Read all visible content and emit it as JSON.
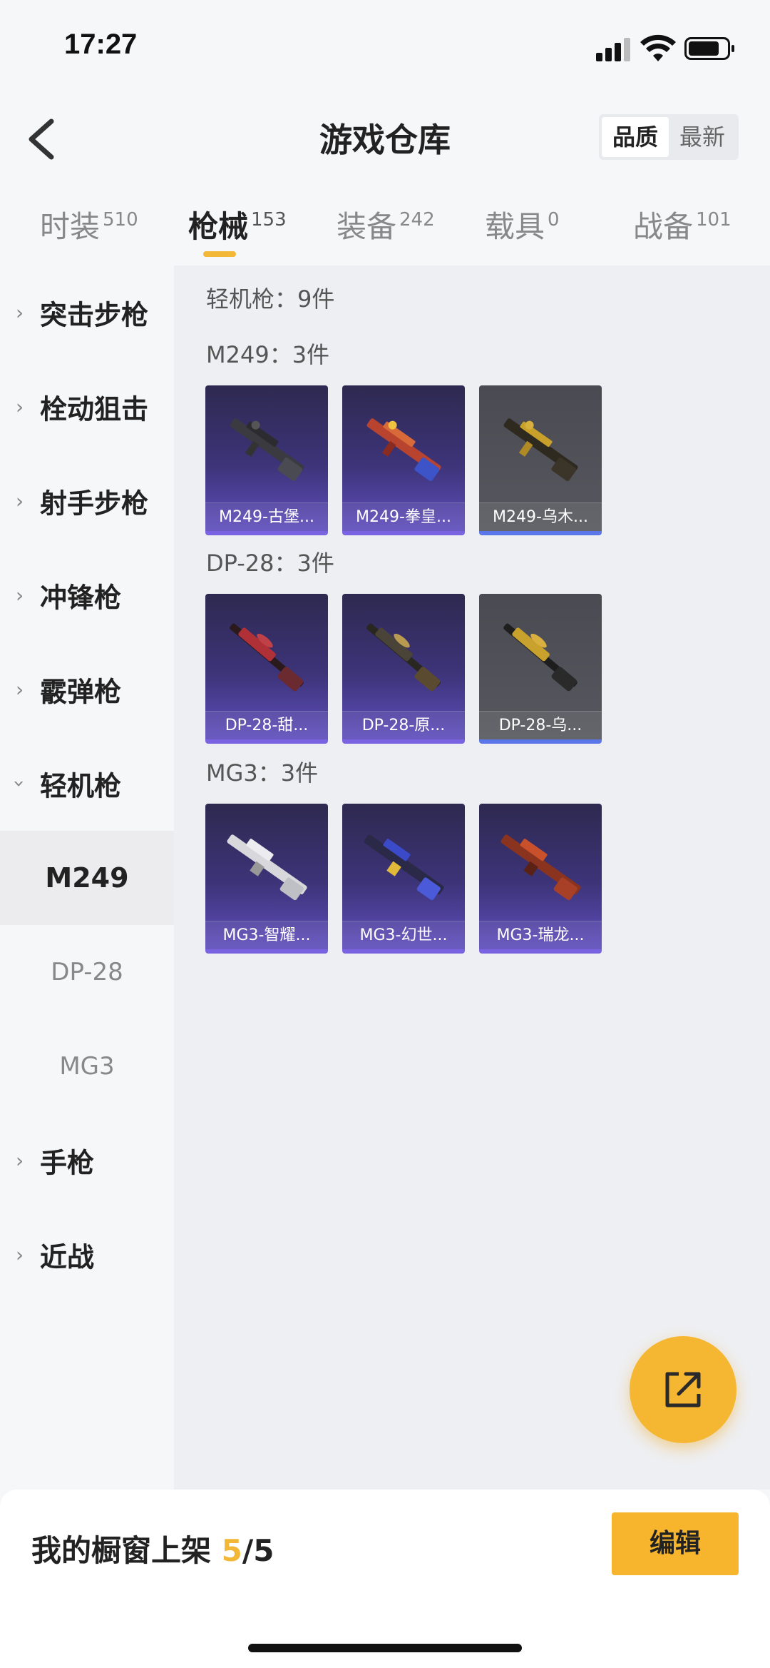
{
  "status": {
    "time": "17:27"
  },
  "header": {
    "title": "游戏仓库",
    "sort_options": [
      "品质",
      "最新"
    ],
    "sort_active": "品质"
  },
  "tabs": [
    {
      "label": "时装",
      "count": "510"
    },
    {
      "label": "枪械",
      "count": "153",
      "active": true
    },
    {
      "label": "装备",
      "count": "242"
    },
    {
      "label": "载具",
      "count": "0"
    },
    {
      "label": "战备",
      "count": "101"
    }
  ],
  "sidebar": {
    "categories": [
      {
        "label": "突击步枪"
      },
      {
        "label": "栓动狙击"
      },
      {
        "label": "射手步枪"
      },
      {
        "label": "冲锋枪"
      },
      {
        "label": "霰弹枪"
      },
      {
        "label": "轻机枪",
        "expanded": true
      }
    ],
    "subitems": [
      {
        "label": "M249",
        "active": true
      },
      {
        "label": "DP-28"
      },
      {
        "label": "MG3"
      }
    ],
    "more_categories": [
      {
        "label": "手枪"
      },
      {
        "label": "近战"
      }
    ]
  },
  "content": {
    "category_title": "轻机枪：9件",
    "groups": [
      {
        "title": "M249：3件",
        "items": [
          {
            "label": "M249-古堡...",
            "rarity": "purple"
          },
          {
            "label": "M249-拳皇...",
            "rarity": "purple"
          },
          {
            "label": "M249-乌木...",
            "rarity": "gray"
          }
        ]
      },
      {
        "title": "DP-28：3件",
        "items": [
          {
            "label": "DP-28-甜...",
            "rarity": "purple"
          },
          {
            "label": "DP-28-原...",
            "rarity": "purple"
          },
          {
            "label": "DP-28-乌...",
            "rarity": "gray"
          }
        ]
      },
      {
        "title": "MG3：3件",
        "items": [
          {
            "label": "MG3-智耀...",
            "rarity": "purple"
          },
          {
            "label": "MG3-幻世...",
            "rarity": "purple"
          },
          {
            "label": "MG3-瑞龙...",
            "rarity": "purple"
          }
        ]
      }
    ]
  },
  "bottom": {
    "showcase_prefix": "我的橱窗上架 ",
    "showcase_current": "5",
    "showcase_total": "/5",
    "edit_label": "编辑"
  },
  "icons": {
    "fab": "share-icon",
    "back": "back-arrow-icon"
  },
  "colors": {
    "accent": "#f2b736",
    "rarity_purple": "#7a63e0",
    "rarity_gray_underline": "#5a76e8"
  }
}
